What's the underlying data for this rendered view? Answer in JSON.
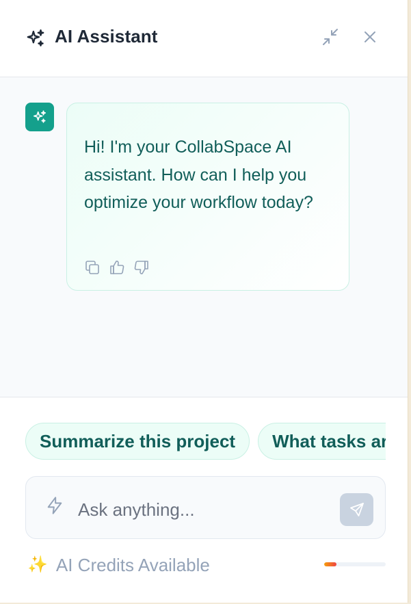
{
  "header": {
    "title": "AI Assistant",
    "title_icon": "sparkles-icon",
    "minimize_icon": "minimize-icon",
    "close_icon": "close-icon"
  },
  "chat": {
    "messages": [
      {
        "role": "assistant",
        "avatar_icon": "sparkles-icon",
        "text": "Hi! I'm your CollabSpace AI assistant. How can I help you optimize your workflow today?",
        "actions": [
          "copy-icon",
          "thumbs-up-icon",
          "thumbs-down-icon"
        ]
      }
    ]
  },
  "suggestions": [
    "Summarize this project",
    "What tasks are due today?"
  ],
  "input": {
    "placeholder": "Ask anything...",
    "value": "",
    "left_icon": "lightning-icon",
    "send_icon": "send-icon"
  },
  "credits": {
    "icon": "✨",
    "label": "AI Credits Available",
    "remaining_fraction": 0.2
  },
  "colors": {
    "accent": "#14a08c",
    "accent_text": "#115e59",
    "bubble_bg": "#ecfdf7",
    "send_disabled": "#c9d3e0",
    "credit_bar": "#ef4444"
  }
}
